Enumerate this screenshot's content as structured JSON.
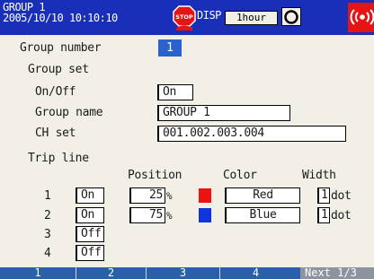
{
  "header": {
    "group_title": "GROUP 1",
    "datetime": "2005/10/10 10:10:10",
    "stop_icon": "stop-icon",
    "disp_label": "DISP",
    "time_span": "1hour",
    "camera_icon": "camera-icon",
    "alarm_icon": "alarm-icon",
    "colors": {
      "header_bg": "#1a2fb8",
      "alarm": "#e51515"
    }
  },
  "group_number": {
    "label": "Group number",
    "value": "1"
  },
  "group_set": {
    "heading": "Group set",
    "onoff_label": "On/Off",
    "onoff_value": "On",
    "name_label": "Group name",
    "name_value": "GROUP 1",
    "ch_label": "CH set",
    "ch_value": "001.002.003.004"
  },
  "trip_line": {
    "heading": "Trip line",
    "col_position": "Position",
    "col_color": "Color",
    "col_width": "Width",
    "position_unit": "%",
    "width_unit": "dot",
    "rows": [
      {
        "num": "1",
        "state": "On",
        "position": "25",
        "color_name": "Red",
        "color_hex": "#ee1111",
        "width": "1"
      },
      {
        "num": "2",
        "state": "On",
        "position": "75",
        "color_name": "Blue",
        "color_hex": "#1133dd",
        "width": "1"
      },
      {
        "num": "3",
        "state": "Off"
      },
      {
        "num": "4",
        "state": "Off"
      }
    ]
  },
  "softkeys": [
    "1",
    "2",
    "3",
    "4",
    "Next 1/3"
  ]
}
